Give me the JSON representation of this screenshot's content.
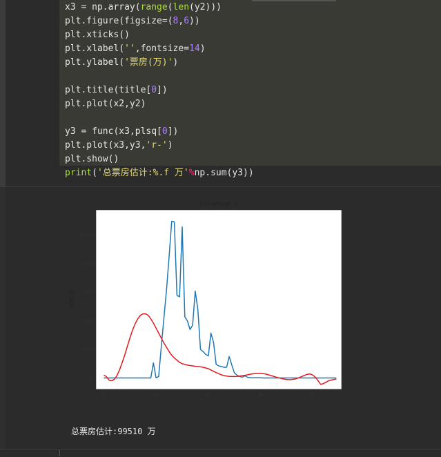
{
  "code_lines": [
    {
      "segments": [
        {
          "t": "x3 = np.array(",
          "c": ""
        },
        {
          "t": "range",
          "c": "kw-green"
        },
        {
          "t": "(",
          "c": ""
        },
        {
          "t": "len",
          "c": "kw-green"
        },
        {
          "t": "(y2)))",
          "c": ""
        }
      ]
    },
    {
      "segments": [
        {
          "t": "plt.figure(figsize=(",
          "c": ""
        },
        {
          "t": "8",
          "c": "kw-num"
        },
        {
          "t": ",",
          "c": ""
        },
        {
          "t": "6",
          "c": "kw-num"
        },
        {
          "t": "))",
          "c": ""
        }
      ]
    },
    {
      "segments": [
        {
          "t": "plt.xticks()",
          "c": ""
        }
      ]
    },
    {
      "segments": [
        {
          "t": "plt.xlabel(",
          "c": ""
        },
        {
          "t": "''",
          "c": "kw-str"
        },
        {
          "t": ",fontsize=",
          "c": ""
        },
        {
          "t": "14",
          "c": "kw-num"
        },
        {
          "t": ")",
          "c": ""
        }
      ]
    },
    {
      "segments": [
        {
          "t": "plt.ylabel(",
          "c": ""
        },
        {
          "t": "'票房(万)'",
          "c": "kw-str"
        },
        {
          "t": ")",
          "c": ""
        }
      ]
    },
    {
      "segments": [
        {
          "t": "",
          "c": ""
        }
      ]
    },
    {
      "segments": [
        {
          "t": "plt.title(title[",
          "c": ""
        },
        {
          "t": "0",
          "c": "kw-num"
        },
        {
          "t": "])",
          "c": ""
        }
      ]
    },
    {
      "segments": [
        {
          "t": "plt.plot(x2,y2)",
          "c": ""
        }
      ]
    },
    {
      "segments": [
        {
          "t": "",
          "c": ""
        }
      ]
    },
    {
      "segments": [
        {
          "t": "y3 = func(x3,plsq[",
          "c": ""
        },
        {
          "t": "0",
          "c": "kw-num"
        },
        {
          "t": "])",
          "c": ""
        }
      ]
    },
    {
      "segments": [
        {
          "t": "plt.plot(x3,y3,",
          "c": ""
        },
        {
          "t": "'r-'",
          "c": "kw-str"
        },
        {
          "t": ")",
          "c": ""
        }
      ]
    },
    {
      "segments": [
        {
          "t": "plt.show()",
          "c": ""
        }
      ]
    },
    {
      "segments": [
        {
          "t": "print",
          "c": "kw-green"
        },
        {
          "t": "(",
          "c": ""
        },
        {
          "t": "'总票房估计:%.f 万'",
          "c": "kw-str"
        },
        {
          "t": "%",
          "c": "kw-op"
        },
        {
          "t": "np.sum(y3))",
          "c": ""
        }
      ]
    }
  ],
  "output_text": "总票房估计:99510 万",
  "chart_data": {
    "type": "line",
    "title": "Unnamed: 0",
    "xlabel": "",
    "ylabel": "票房(万)",
    "xlim": [
      -3,
      91
    ],
    "ylim": [
      -800,
      11800
    ],
    "xticks": [
      0,
      20,
      40,
      60,
      80
    ],
    "yticks": [
      0,
      2000,
      4000,
      6000,
      8000,
      10000
    ],
    "series": [
      {
        "color": "#1f77b4",
        "x": [
          0,
          1,
          2,
          3,
          4,
          5,
          6,
          7,
          8,
          9,
          10,
          11,
          12,
          13,
          14,
          15,
          16,
          17,
          18,
          19,
          20,
          21,
          22,
          23,
          24,
          25,
          26,
          27,
          28,
          29,
          30,
          31,
          32,
          33,
          34,
          35,
          36,
          37,
          38,
          39,
          40,
          41,
          42,
          43,
          44,
          45,
          46,
          47,
          48,
          49,
          50,
          51,
          52,
          53,
          54,
          55,
          56,
          57,
          58,
          59,
          60,
          61,
          62,
          63,
          64,
          65,
          66,
          67,
          68,
          69,
          70,
          71,
          72,
          73,
          74,
          75,
          76,
          77,
          78,
          79,
          80,
          81,
          82,
          83,
          84,
          85,
          86,
          87,
          88,
          89
        ],
        "y": [
          0,
          0,
          0,
          0,
          0,
          0,
          0,
          0,
          0,
          0,
          0,
          0,
          0,
          0,
          0,
          0,
          0,
          0,
          0,
          1050,
          10,
          100,
          2200,
          4200,
          6200,
          8500,
          11000,
          10950,
          5800,
          5700,
          10600,
          4300,
          4000,
          3400,
          3700,
          6100,
          4800,
          2000,
          1850,
          1650,
          1550,
          3150,
          2500,
          950,
          850,
          800,
          750,
          750,
          1500,
          900,
          350,
          200,
          100,
          60,
          150,
          50,
          20,
          10,
          10,
          10,
          10,
          0,
          0,
          0,
          0,
          0,
          0,
          0,
          0,
          0,
          0,
          0,
          0,
          0,
          0,
          0,
          0,
          0,
          0,
          0,
          0,
          0,
          0,
          0,
          0,
          0,
          0,
          0,
          0,
          0
        ]
      },
      {
        "color": "#e31a1c",
        "x": [
          0,
          1,
          2,
          3,
          4,
          5,
          6,
          7,
          8,
          9,
          10,
          11,
          12,
          13,
          14,
          15,
          16,
          17,
          18,
          19,
          20,
          21,
          22,
          23,
          24,
          25,
          26,
          27,
          28,
          29,
          30,
          31,
          32,
          33,
          34,
          35,
          36,
          37,
          38,
          39,
          40,
          41,
          42,
          43,
          44,
          45,
          46,
          47,
          48,
          49,
          50,
          51,
          52,
          53,
          54,
          55,
          56,
          57,
          58,
          59,
          60,
          61,
          62,
          63,
          64,
          65,
          66,
          67,
          68,
          69,
          70,
          71,
          72,
          73,
          74,
          75,
          76,
          77,
          78,
          79,
          80,
          81,
          82,
          83,
          84,
          85,
          86,
          87,
          88,
          89
        ],
        "y": [
          200,
          100,
          -150,
          -200,
          -100,
          150,
          550,
          1050,
          1600,
          2200,
          2800,
          3350,
          3800,
          4150,
          4400,
          4500,
          4500,
          4400,
          4150,
          3850,
          3500,
          3150,
          2800,
          2450,
          2150,
          1850,
          1600,
          1400,
          1250,
          1100,
          1000,
          950,
          900,
          870,
          850,
          820,
          800,
          780,
          750,
          700,
          650,
          560,
          470,
          380,
          300,
          220,
          170,
          130,
          110,
          100,
          100,
          110,
          130,
          160,
          190,
          220,
          260,
          290,
          310,
          320,
          320,
          300,
          270,
          220,
          170,
          110,
          60,
          10,
          -40,
          -80,
          -110,
          -120,
          -110,
          -80,
          -30,
          40,
          120,
          200,
          260,
          280,
          200,
          50,
          -200,
          -450,
          -400,
          -300,
          -200,
          -150,
          -100,
          -80
        ]
      }
    ]
  }
}
